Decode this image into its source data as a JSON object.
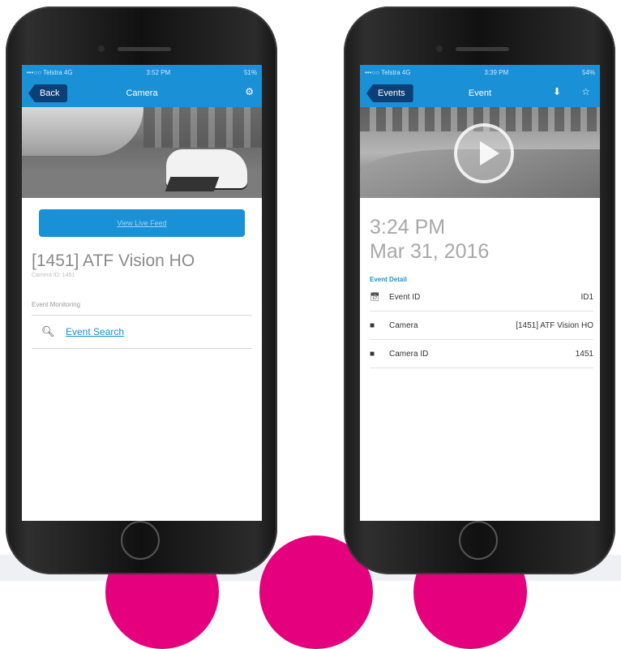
{
  "colors": {
    "accent": "#1a90d6",
    "back_button": "#0d3f77",
    "blob": "#e5007e"
  },
  "left_phone": {
    "status": {
      "carrier": "•••○○ Telstra 4G",
      "time": "3:52 PM",
      "battery": "51%"
    },
    "nav": {
      "back_label": "Back",
      "title": "Camera",
      "right_icon": "gear-icon"
    },
    "live_button": "View Live Feed",
    "camera_name": "[1451] ATF Vision HO",
    "camera_id": "Camera ID: 1451",
    "section_label": "Event Monitoring",
    "search_link": "Event Search",
    "search_icon": "search-icon"
  },
  "right_phone": {
    "status": {
      "carrier": "•••○○ Telstra 4G",
      "time": "3:39 PM",
      "battery": "54%"
    },
    "nav": {
      "back_label": "Events",
      "title": "Event",
      "download_icon": "download-icon",
      "star_icon": "star-icon"
    },
    "event_time": "3:24 PM",
    "event_date": "Mar 31, 2016",
    "detail_label": "Event Detail",
    "rows": [
      {
        "icon": "calendar-icon",
        "label": "Event ID",
        "value": "ID1"
      },
      {
        "icon": "camera-icon",
        "label": "Camera",
        "value": "[1451] ATF Vision HO"
      },
      {
        "icon": "camera-icon",
        "label": "Camera ID",
        "value": "1451"
      }
    ]
  }
}
